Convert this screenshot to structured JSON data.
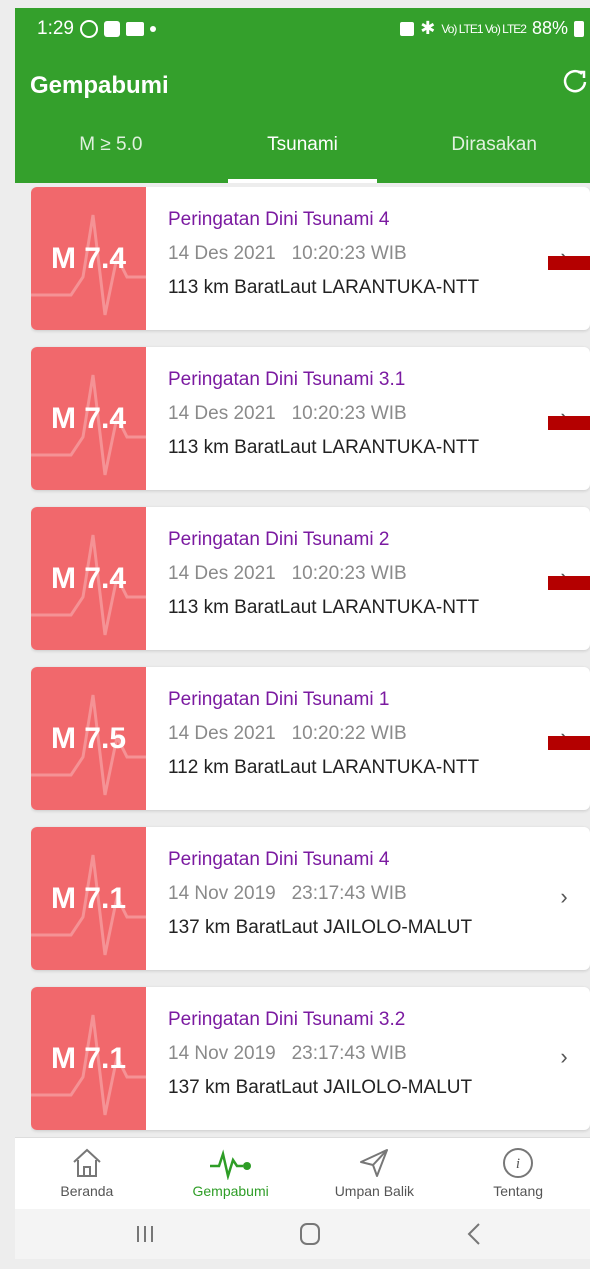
{
  "status_bar": {
    "time": "1:29",
    "signal_text": "Vo) LTE1 Vo) LTE2",
    "battery": "88%"
  },
  "app": {
    "title": "Gempabumi",
    "refresh_icon": "refresh-icon"
  },
  "tabs": [
    {
      "label": "M ≥ 5.0"
    },
    {
      "label": "Tsunami"
    },
    {
      "label": "Dirasakan"
    }
  ],
  "cards": [
    {
      "mag": "M 7.4",
      "title": "Peringatan Dini Tsunami 4",
      "datetime": "14 Des 2021   10:20:23 WIB",
      "location": "113 km BaratLaut LARANTUKA-NTT"
    },
    {
      "mag": "M 7.4",
      "title": "Peringatan Dini Tsunami 3.1",
      "datetime": "14 Des 2021   10:20:23 WIB",
      "location": "113 km BaratLaut LARANTUKA-NTT"
    },
    {
      "mag": "M 7.4",
      "title": "Peringatan Dini Tsunami 2",
      "datetime": "14 Des 2021   10:20:23 WIB",
      "location": "113 km BaratLaut LARANTUKA-NTT"
    },
    {
      "mag": "M 7.5",
      "title": "Peringatan Dini Tsunami 1",
      "datetime": "14 Des 2021   10:20:22 WIB",
      "location": "112 km BaratLaut LARANTUKA-NTT"
    },
    {
      "mag": "M 7.1",
      "title": "Peringatan Dini Tsunami 4",
      "datetime": "14 Nov 2019   23:17:43 WIB",
      "location": "137 km BaratLaut JAILOLO-MALUT"
    },
    {
      "mag": "M 7.1",
      "title": "Peringatan Dini Tsunami 3.2",
      "datetime": "14 Nov 2019   23:17:43 WIB",
      "location": "137 km BaratLaut JAILOLO-MALUT"
    }
  ],
  "bottom_nav": [
    {
      "label": "Beranda",
      "icon": "home-icon"
    },
    {
      "label": "Gempabumi",
      "icon": "seismic-wave-icon"
    },
    {
      "label": "Umpan Balik",
      "icon": "send-icon"
    },
    {
      "label": "Tentang",
      "icon": "info-icon"
    }
  ],
  "colors": {
    "app_bar": "#34a02c",
    "magnitude_badge": "#f1686c",
    "title_text": "#7b1aa1",
    "active_nav": "#2e9d26"
  }
}
